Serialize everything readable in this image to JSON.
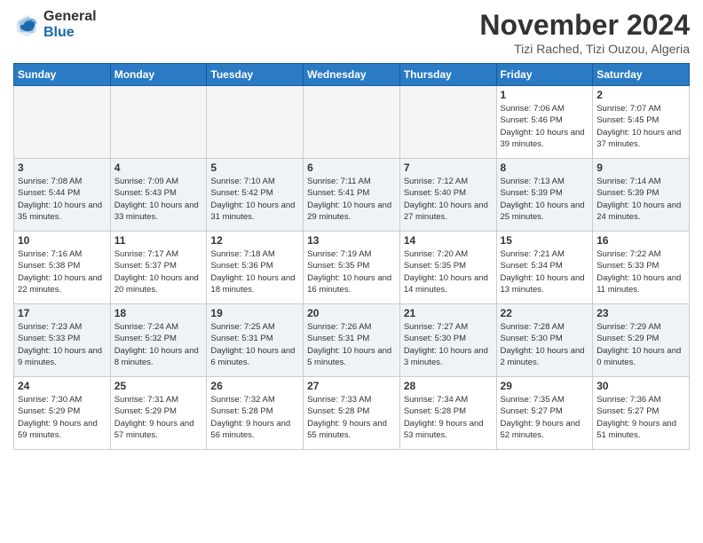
{
  "logo": {
    "general": "General",
    "blue": "Blue"
  },
  "header": {
    "month": "November 2024",
    "location": "Tizi Rached, Tizi Ouzou, Algeria"
  },
  "weekdays": [
    "Sunday",
    "Monday",
    "Tuesday",
    "Wednesday",
    "Thursday",
    "Friday",
    "Saturday"
  ],
  "weeks": [
    [
      {
        "day": "",
        "info": ""
      },
      {
        "day": "",
        "info": ""
      },
      {
        "day": "",
        "info": ""
      },
      {
        "day": "",
        "info": ""
      },
      {
        "day": "",
        "info": ""
      },
      {
        "day": "1",
        "info": "Sunrise: 7:06 AM\nSunset: 5:46 PM\nDaylight: 10 hours and 39 minutes."
      },
      {
        "day": "2",
        "info": "Sunrise: 7:07 AM\nSunset: 5:45 PM\nDaylight: 10 hours and 37 minutes."
      }
    ],
    [
      {
        "day": "3",
        "info": "Sunrise: 7:08 AM\nSunset: 5:44 PM\nDaylight: 10 hours and 35 minutes."
      },
      {
        "day": "4",
        "info": "Sunrise: 7:09 AM\nSunset: 5:43 PM\nDaylight: 10 hours and 33 minutes."
      },
      {
        "day": "5",
        "info": "Sunrise: 7:10 AM\nSunset: 5:42 PM\nDaylight: 10 hours and 31 minutes."
      },
      {
        "day": "6",
        "info": "Sunrise: 7:11 AM\nSunset: 5:41 PM\nDaylight: 10 hours and 29 minutes."
      },
      {
        "day": "7",
        "info": "Sunrise: 7:12 AM\nSunset: 5:40 PM\nDaylight: 10 hours and 27 minutes."
      },
      {
        "day": "8",
        "info": "Sunrise: 7:13 AM\nSunset: 5:39 PM\nDaylight: 10 hours and 25 minutes."
      },
      {
        "day": "9",
        "info": "Sunrise: 7:14 AM\nSunset: 5:39 PM\nDaylight: 10 hours and 24 minutes."
      }
    ],
    [
      {
        "day": "10",
        "info": "Sunrise: 7:16 AM\nSunset: 5:38 PM\nDaylight: 10 hours and 22 minutes."
      },
      {
        "day": "11",
        "info": "Sunrise: 7:17 AM\nSunset: 5:37 PM\nDaylight: 10 hours and 20 minutes."
      },
      {
        "day": "12",
        "info": "Sunrise: 7:18 AM\nSunset: 5:36 PM\nDaylight: 10 hours and 18 minutes."
      },
      {
        "day": "13",
        "info": "Sunrise: 7:19 AM\nSunset: 5:35 PM\nDaylight: 10 hours and 16 minutes."
      },
      {
        "day": "14",
        "info": "Sunrise: 7:20 AM\nSunset: 5:35 PM\nDaylight: 10 hours and 14 minutes."
      },
      {
        "day": "15",
        "info": "Sunrise: 7:21 AM\nSunset: 5:34 PM\nDaylight: 10 hours and 13 minutes."
      },
      {
        "day": "16",
        "info": "Sunrise: 7:22 AM\nSunset: 5:33 PM\nDaylight: 10 hours and 11 minutes."
      }
    ],
    [
      {
        "day": "17",
        "info": "Sunrise: 7:23 AM\nSunset: 5:33 PM\nDaylight: 10 hours and 9 minutes."
      },
      {
        "day": "18",
        "info": "Sunrise: 7:24 AM\nSunset: 5:32 PM\nDaylight: 10 hours and 8 minutes."
      },
      {
        "day": "19",
        "info": "Sunrise: 7:25 AM\nSunset: 5:31 PM\nDaylight: 10 hours and 6 minutes."
      },
      {
        "day": "20",
        "info": "Sunrise: 7:26 AM\nSunset: 5:31 PM\nDaylight: 10 hours and 5 minutes."
      },
      {
        "day": "21",
        "info": "Sunrise: 7:27 AM\nSunset: 5:30 PM\nDaylight: 10 hours and 3 minutes."
      },
      {
        "day": "22",
        "info": "Sunrise: 7:28 AM\nSunset: 5:30 PM\nDaylight: 10 hours and 2 minutes."
      },
      {
        "day": "23",
        "info": "Sunrise: 7:29 AM\nSunset: 5:29 PM\nDaylight: 10 hours and 0 minutes."
      }
    ],
    [
      {
        "day": "24",
        "info": "Sunrise: 7:30 AM\nSunset: 5:29 PM\nDaylight: 9 hours and 59 minutes."
      },
      {
        "day": "25",
        "info": "Sunrise: 7:31 AM\nSunset: 5:29 PM\nDaylight: 9 hours and 57 minutes."
      },
      {
        "day": "26",
        "info": "Sunrise: 7:32 AM\nSunset: 5:28 PM\nDaylight: 9 hours and 56 minutes."
      },
      {
        "day": "27",
        "info": "Sunrise: 7:33 AM\nSunset: 5:28 PM\nDaylight: 9 hours and 55 minutes."
      },
      {
        "day": "28",
        "info": "Sunrise: 7:34 AM\nSunset: 5:28 PM\nDaylight: 9 hours and 53 minutes."
      },
      {
        "day": "29",
        "info": "Sunrise: 7:35 AM\nSunset: 5:27 PM\nDaylight: 9 hours and 52 minutes."
      },
      {
        "day": "30",
        "info": "Sunrise: 7:36 AM\nSunset: 5:27 PM\nDaylight: 9 hours and 51 minutes."
      }
    ]
  ]
}
